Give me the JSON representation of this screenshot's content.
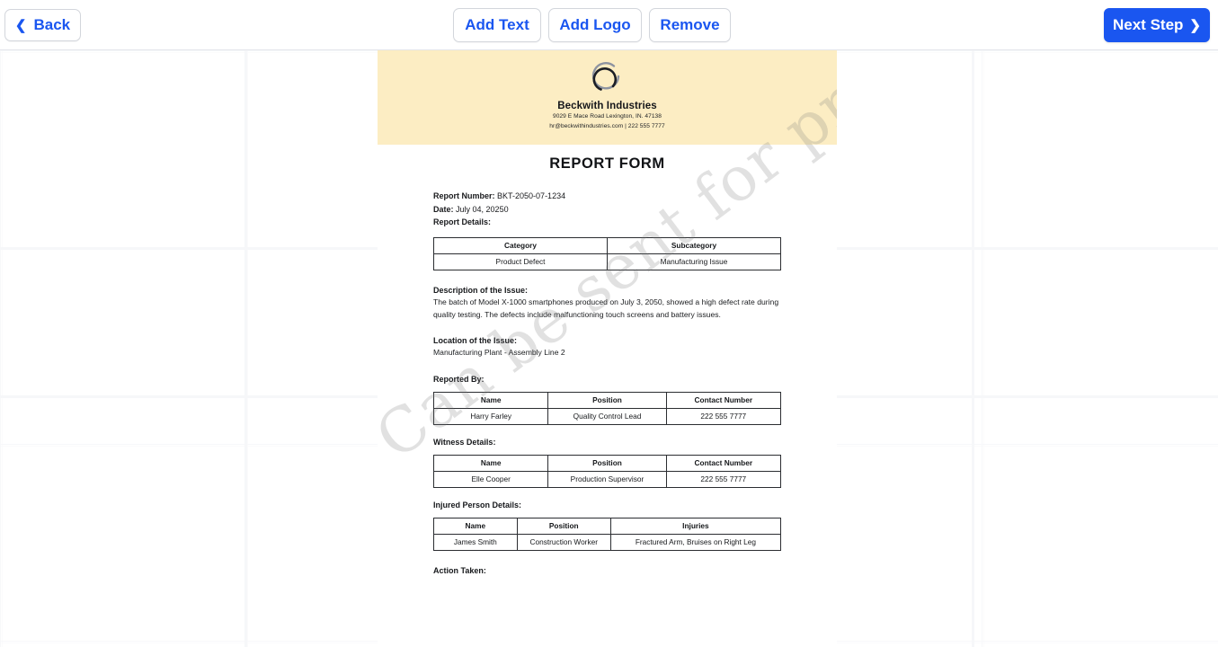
{
  "toolbar": {
    "back_label": "Back",
    "back_icon": "chevron-left-icon",
    "add_text_label": "Add Text",
    "add_logo_label": "Add Logo",
    "remove_label": "Remove",
    "next_label": "Next Step",
    "next_icon": "chevron-right-icon",
    "accent_color": "#1a56f0"
  },
  "document": {
    "letterhead": {
      "background_color": "#fcedc3",
      "logo_icon": "broken-circle-logo-icon",
      "company_name": "Beckwith Industries",
      "address": "9029 E Mace Road Lexington, IN. 47138",
      "contact": "hr@beckwithindustries.com | 222 555 7777"
    },
    "title": "REPORT FORM",
    "report_number_label": "Report Number:",
    "report_number_value": "BKT-2050-07-1234",
    "date_label": "Date:",
    "date_value": "July 04, 20250",
    "report_details_label": "Report Details:",
    "details_table": {
      "headers": [
        "Category",
        "Subcategory"
      ],
      "rows": [
        [
          "Product Defect",
          "Manufacturing Issue"
        ]
      ]
    },
    "description_label": "Description of the Issue:",
    "description_text": "The batch of Model X-1000 smartphones produced on July 3, 2050, showed a high defect rate during quality testing. The defects include malfunctioning touch screens and battery issues.",
    "location_label": "Location of the Issue:",
    "location_text": "Manufacturing Plant - Assembly Line 2",
    "reported_by_label": "Reported By:",
    "reported_by_table": {
      "headers": [
        "Name",
        "Position",
        "Contact Number"
      ],
      "rows": [
        [
          "Harry Farley",
          "Quality Control Lead",
          "222 555 7777"
        ]
      ]
    },
    "witness_label": "Witness Details:",
    "witness_table": {
      "headers": [
        "Name",
        "Position",
        "Contact Number"
      ],
      "rows": [
        [
          "Elle Cooper",
          "Production Supervisor",
          "222 555 7777"
        ]
      ]
    },
    "injured_label": "Injured Person Details:",
    "injured_table": {
      "headers": [
        "Name",
        "Position",
        "Injuries"
      ],
      "rows": [
        [
          "James Smith",
          "Construction Worker",
          "Fractured Arm, Bruises on Right Leg"
        ]
      ]
    },
    "action_taken_label": "Action Taken:",
    "watermark_text": "Can be sent for printing"
  }
}
